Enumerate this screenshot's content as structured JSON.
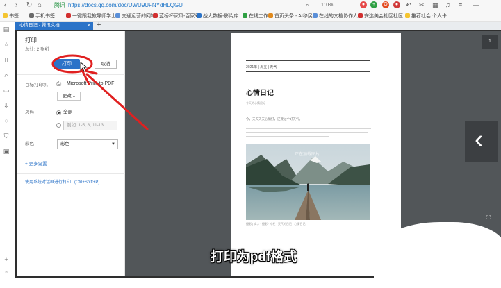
{
  "browser": {
    "url": "https://docs.qq.com/doc/DWU9UFNYdHLQGU",
    "site_label": "腾讯",
    "zoom": "110%",
    "bookmarks": [
      "书签",
      "手机书签",
      "一键跟我教导师学士",
      "交通运营的网站",
      "蓝桥杯家风-百家号",
      "战大数据-影片库",
      "在线工作",
      "首页头条 - AI移民",
      "在线的文档协作人员",
      "安选美会社区社区",
      "推荐社会 个人卡"
    ],
    "tab": {
      "label": "心情日记 - 腾讯文档",
      "close": "×"
    },
    "new_tab": "+"
  },
  "print_panel": {
    "title": "打印",
    "total_pages": "总计: 2 张纸",
    "print_button": "打印",
    "cancel_button": "取消",
    "target_label": "目标打印机",
    "printer_name": "Microsoft Print to PDF",
    "change_button": "更改...",
    "pages_label": "页码",
    "pages_all": "全部",
    "pages_range_placeholder": "例如: 1-5, 8, 11-13",
    "color_label": "彩色",
    "color_value": "彩色",
    "more_settings": "+ 更多设置",
    "system_dialog": "使用系统对话框进行打印...(Ctrl+Shift+P)"
  },
  "preview": {
    "header": "2021年 | 周五 | 天气",
    "doc_title": "心情日记",
    "doc_subtitle": "今天的心情很好",
    "para_first": "今，天天天天心情好，还要过个好天气。",
    "image_caption": "正在加载图片",
    "footer": "摄影 | 文字 · 摄影 · 专栏 · 天气的日记 · 心情日记",
    "page_indicator": "1",
    "next_arrow": "‹"
  },
  "overlay": {
    "subtitle": "打印为pdf格式"
  },
  "colors": {
    "accent": "#2b73c8",
    "annotation": "#e02020",
    "preview_bg": "#525659"
  }
}
